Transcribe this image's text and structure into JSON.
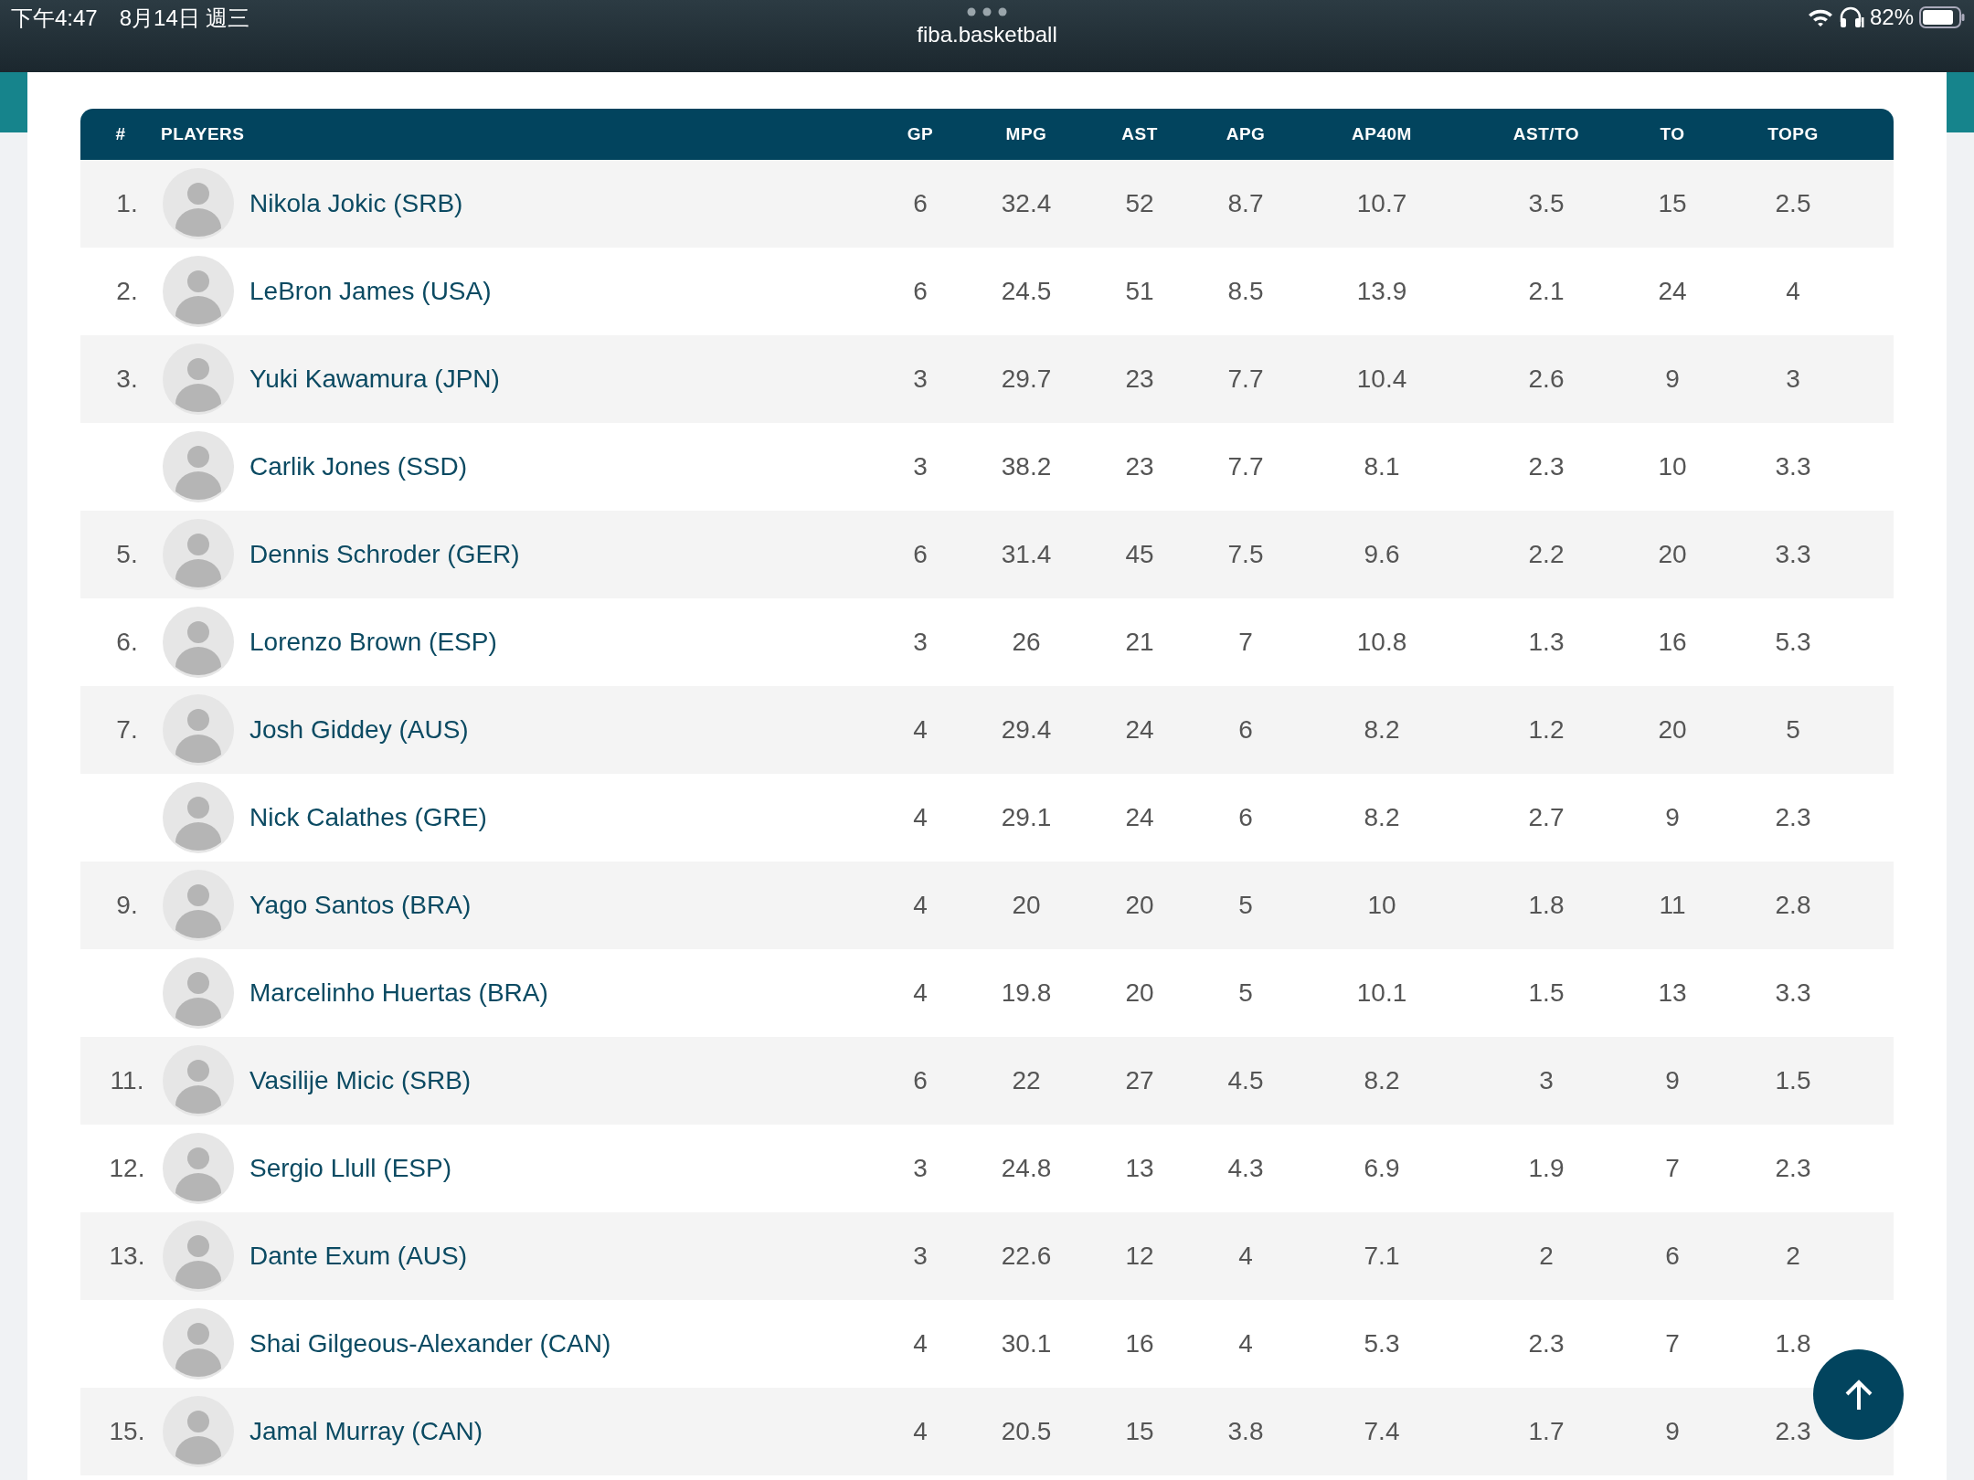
{
  "status_bar": {
    "time": "下午4:47",
    "date": "8月14日 週三",
    "url": "fiba.basketball",
    "battery": "82%"
  },
  "table": {
    "columns": [
      "#",
      "PLAYERS",
      "GP",
      "MPG",
      "AST",
      "APG",
      "AP40M",
      "AST/TO",
      "TO",
      "TOPG"
    ],
    "rows": [
      {
        "rank": "1.",
        "player": "Nikola Jokic (SRB)",
        "values": [
          "6",
          "32.4",
          "52",
          "8.7",
          "10.7",
          "3.5",
          "15",
          "2.5"
        ]
      },
      {
        "rank": "2.",
        "player": "LeBron James (USA)",
        "values": [
          "6",
          "24.5",
          "51",
          "8.5",
          "13.9",
          "2.1",
          "24",
          "4"
        ]
      },
      {
        "rank": "3.",
        "player": "Yuki Kawamura (JPN)",
        "values": [
          "3",
          "29.7",
          "23",
          "7.7",
          "10.4",
          "2.6",
          "9",
          "3"
        ]
      },
      {
        "player": "Carlik Jones (SSD)",
        "values": [
          "3",
          "38.2",
          "23",
          "7.7",
          "8.1",
          "2.3",
          "10",
          "3.3"
        ]
      },
      {
        "rank": "5.",
        "player": "Dennis Schroder (GER)",
        "values": [
          "6",
          "31.4",
          "45",
          "7.5",
          "9.6",
          "2.2",
          "20",
          "3.3"
        ]
      },
      {
        "rank": "6.",
        "player": "Lorenzo Brown (ESP)",
        "values": [
          "3",
          "26",
          "21",
          "7",
          "10.8",
          "1.3",
          "16",
          "5.3"
        ]
      },
      {
        "rank": "7.",
        "player": "Josh Giddey (AUS)",
        "values": [
          "4",
          "29.4",
          "24",
          "6",
          "8.2",
          "1.2",
          "20",
          "5"
        ]
      },
      {
        "player": "Nick Calathes (GRE)",
        "values": [
          "4",
          "29.1",
          "24",
          "6",
          "8.2",
          "2.7",
          "9",
          "2.3"
        ]
      },
      {
        "rank": "9.",
        "player": "Yago Santos (BRA)",
        "values": [
          "4",
          "20",
          "20",
          "5",
          "10",
          "1.8",
          "11",
          "2.8"
        ]
      },
      {
        "player": "Marcelinho Huertas (BRA)",
        "values": [
          "4",
          "19.8",
          "20",
          "5",
          "10.1",
          "1.5",
          "13",
          "3.3"
        ]
      },
      {
        "rank": "11.",
        "player": "Vasilije Micic (SRB)",
        "values": [
          "6",
          "22",
          "27",
          "4.5",
          "8.2",
          "3",
          "9",
          "1.5"
        ]
      },
      {
        "rank": "12.",
        "player": "Sergio Llull (ESP)",
        "values": [
          "3",
          "24.8",
          "13",
          "4.3",
          "6.9",
          "1.9",
          "7",
          "2.3"
        ]
      },
      {
        "rank": "13.",
        "player": "Dante Exum (AUS)",
        "values": [
          "3",
          "22.6",
          "12",
          "4",
          "7.1",
          "2",
          "6",
          "2"
        ]
      },
      {
        "player": "Shai Gilgeous-Alexander (CAN)",
        "values": [
          "4",
          "30.1",
          "16",
          "4",
          "5.3",
          "2.3",
          "7",
          "1.8"
        ]
      },
      {
        "rank": "15.",
        "player": "Jamal Murray (CAN)",
        "values": [
          "4",
          "20.5",
          "15",
          "3.8",
          "7.4",
          "1.7",
          "9",
          "2.3"
        ]
      }
    ]
  }
}
